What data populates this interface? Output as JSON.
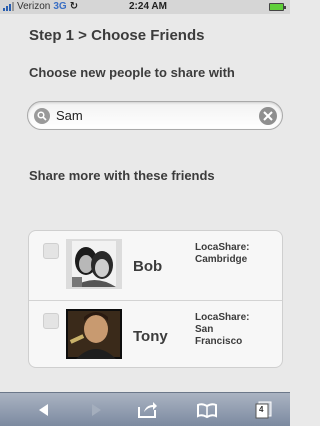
{
  "status_bar": {
    "carrier": "Verizon",
    "network": "3G",
    "time": "2:24 AM"
  },
  "page": {
    "title": "Step 1 > Choose Friends",
    "subtitle": "Choose new people to share with"
  },
  "search": {
    "value": "Sam",
    "placeholder": ""
  },
  "share_more": {
    "heading": "Share more with these friends"
  },
  "friends": [
    {
      "name": "Bob",
      "app": "LocaShare:",
      "location": "Cambridge"
    },
    {
      "name": "Tony",
      "app": "LocaShare:",
      "location": "San\nFrancisco"
    }
  ],
  "toolbar": {
    "tab_count": "4",
    "icons": [
      "back-arrow-icon",
      "forward-arrow-icon",
      "share-icon",
      "bookmarks-icon",
      "tabs-icon"
    ]
  },
  "colors": {
    "background": "#e9e9e9",
    "toolbar": "#8a96aa",
    "text": "#3c3c3c"
  }
}
